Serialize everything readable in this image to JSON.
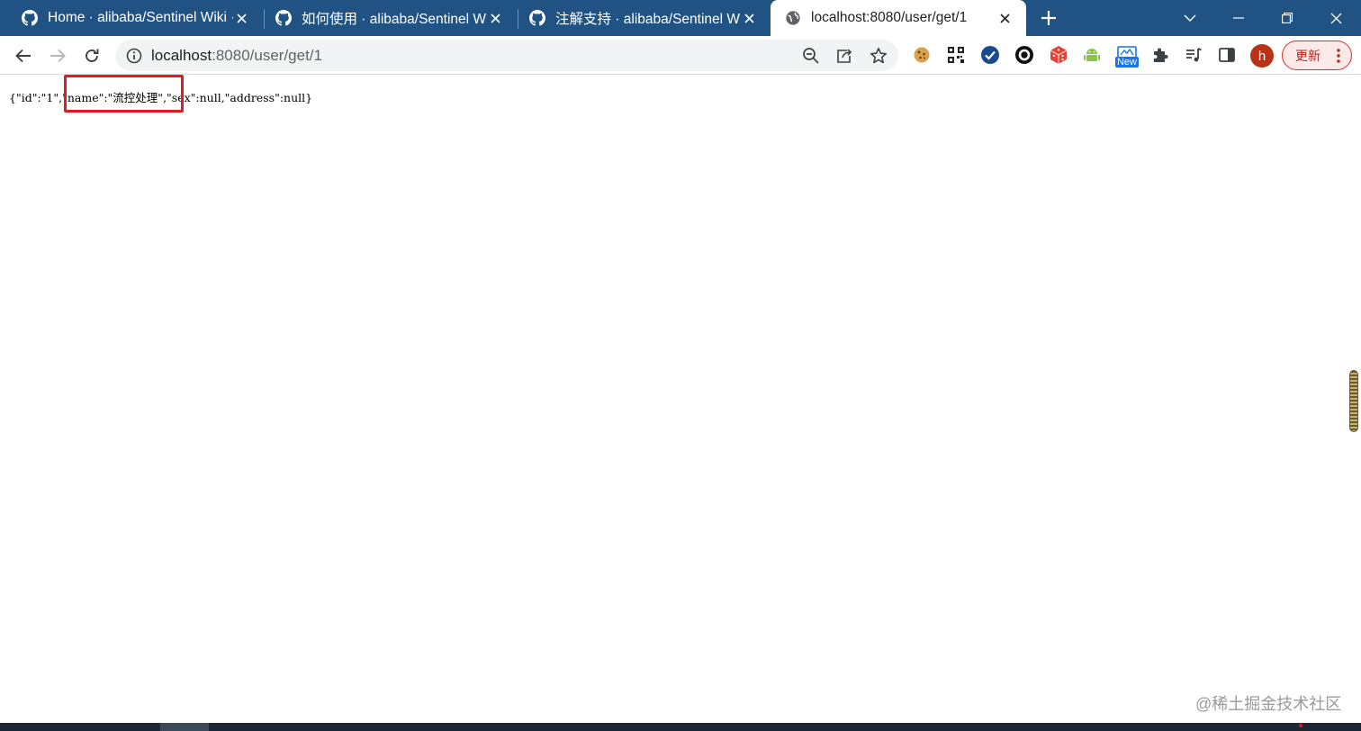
{
  "browser": {
    "tabs": [
      {
        "title": "Home · alibaba/Sentinel Wiki ·",
        "favicon": "github-icon"
      },
      {
        "title": "如何使用 · alibaba/Sentinel Wiki",
        "favicon": "github-icon"
      },
      {
        "title": "注解支持 · alibaba/Sentinel Wiki",
        "favicon": "github-icon"
      },
      {
        "title": "localhost:8080/user/get/1",
        "favicon": "globe-icon",
        "active": true
      }
    ],
    "address": {
      "host": "localhost",
      "rest": ":8080/user/get/1"
    },
    "extensions": [
      "cookie-icon",
      "qr-code-icon",
      "check-circle-icon",
      "ring-icon",
      "dice-icon",
      "android-icon",
      "new-badge-icon",
      "puzzle-icon",
      "media-queue-icon",
      "side-panel-icon"
    ],
    "new_badge": "New",
    "avatar_letter": "h",
    "update_label": "更新"
  },
  "page": {
    "json_part1": "{\"id\":\"1\",",
    "json_part2": "\"name\":\"流控处理\"",
    "json_part3": ",\"sex\":null,\"address\":null}"
  },
  "watermark": "@稀土掘金技术社区",
  "colors": {
    "tabstrip": "#205283",
    "highlight": "#e11b22",
    "update": "#d93025"
  }
}
